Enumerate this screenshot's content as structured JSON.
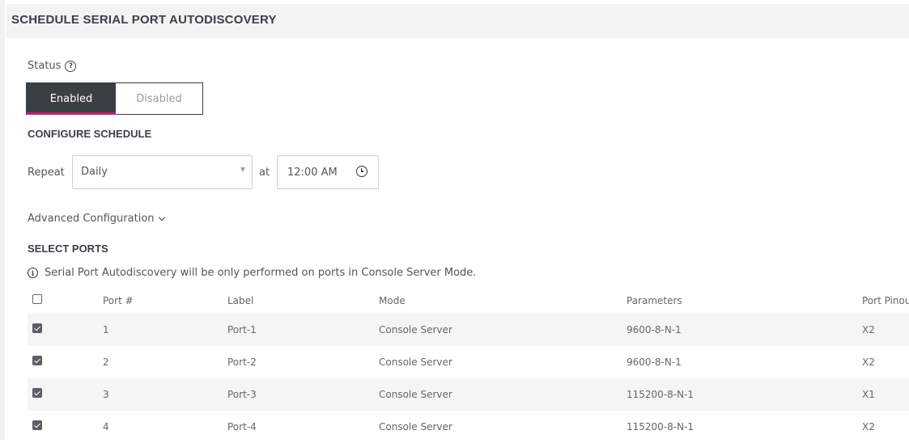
{
  "page": {
    "title": "SCHEDULE SERIAL PORT AUTODISCOVERY"
  },
  "status": {
    "label": "Status",
    "help_icon": "help-circle-icon",
    "options": [
      "Enabled",
      "Disabled"
    ],
    "selected": "Enabled",
    "accent_color": "#c2217c"
  },
  "schedule": {
    "title": "CONFIGURE SCHEDULE",
    "repeat_label": "Repeat",
    "repeat_value": "Daily",
    "at_label": "at",
    "time_value": "12:00 AM",
    "clock_icon": "clock-icon"
  },
  "advanced": {
    "label": "Advanced Configuration",
    "icon": "chevron-down-icon"
  },
  "ports": {
    "title": "SELECT PORTS",
    "info_icon": "info-circle-icon",
    "info": "Serial Port Autodiscovery will be only performed on ports in Console Server Mode.",
    "columns": [
      "Port #",
      "Label",
      "Mode",
      "Parameters",
      "Port Pinou"
    ],
    "select_all_checked": false,
    "rows": [
      {
        "checked": true,
        "port": "1",
        "label": "Port-1",
        "mode": "Console Server",
        "parameters": "9600-8-N-1",
        "pinout": "X2"
      },
      {
        "checked": true,
        "port": "2",
        "label": "Port-2",
        "mode": "Console Server",
        "parameters": "9600-8-N-1",
        "pinout": "X2"
      },
      {
        "checked": true,
        "port": "3",
        "label": "Port-3",
        "mode": "Console Server",
        "parameters": "115200-8-N-1",
        "pinout": "X1"
      },
      {
        "checked": true,
        "port": "4",
        "label": "Port-4",
        "mode": "Console Server",
        "parameters": "115200-8-N-1",
        "pinout": "X2"
      }
    ]
  }
}
